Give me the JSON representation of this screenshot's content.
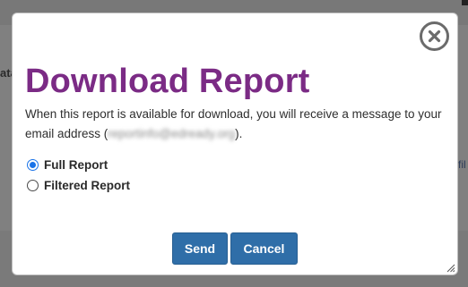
{
  "background": {
    "left_fragment": "ata",
    "right_fragment": "fil"
  },
  "modal": {
    "title": "Download Report",
    "message_before": "When this report is available for download, you will receive a message to your email address (",
    "email_redacted": "reportinfo@edready.org",
    "message_after": ").",
    "options": [
      {
        "label": "Full Report",
        "selected": true
      },
      {
        "label": "Filtered Report",
        "selected": false
      }
    ],
    "buttons": {
      "send": "Send",
      "cancel": "Cancel"
    },
    "icons": {
      "close": "close-circle-icon",
      "resize": "resize-grip-icon"
    }
  },
  "colors": {
    "title": "#7b2b85",
    "button": "#2f6ea8",
    "radio_selected": "#1a73e8"
  }
}
